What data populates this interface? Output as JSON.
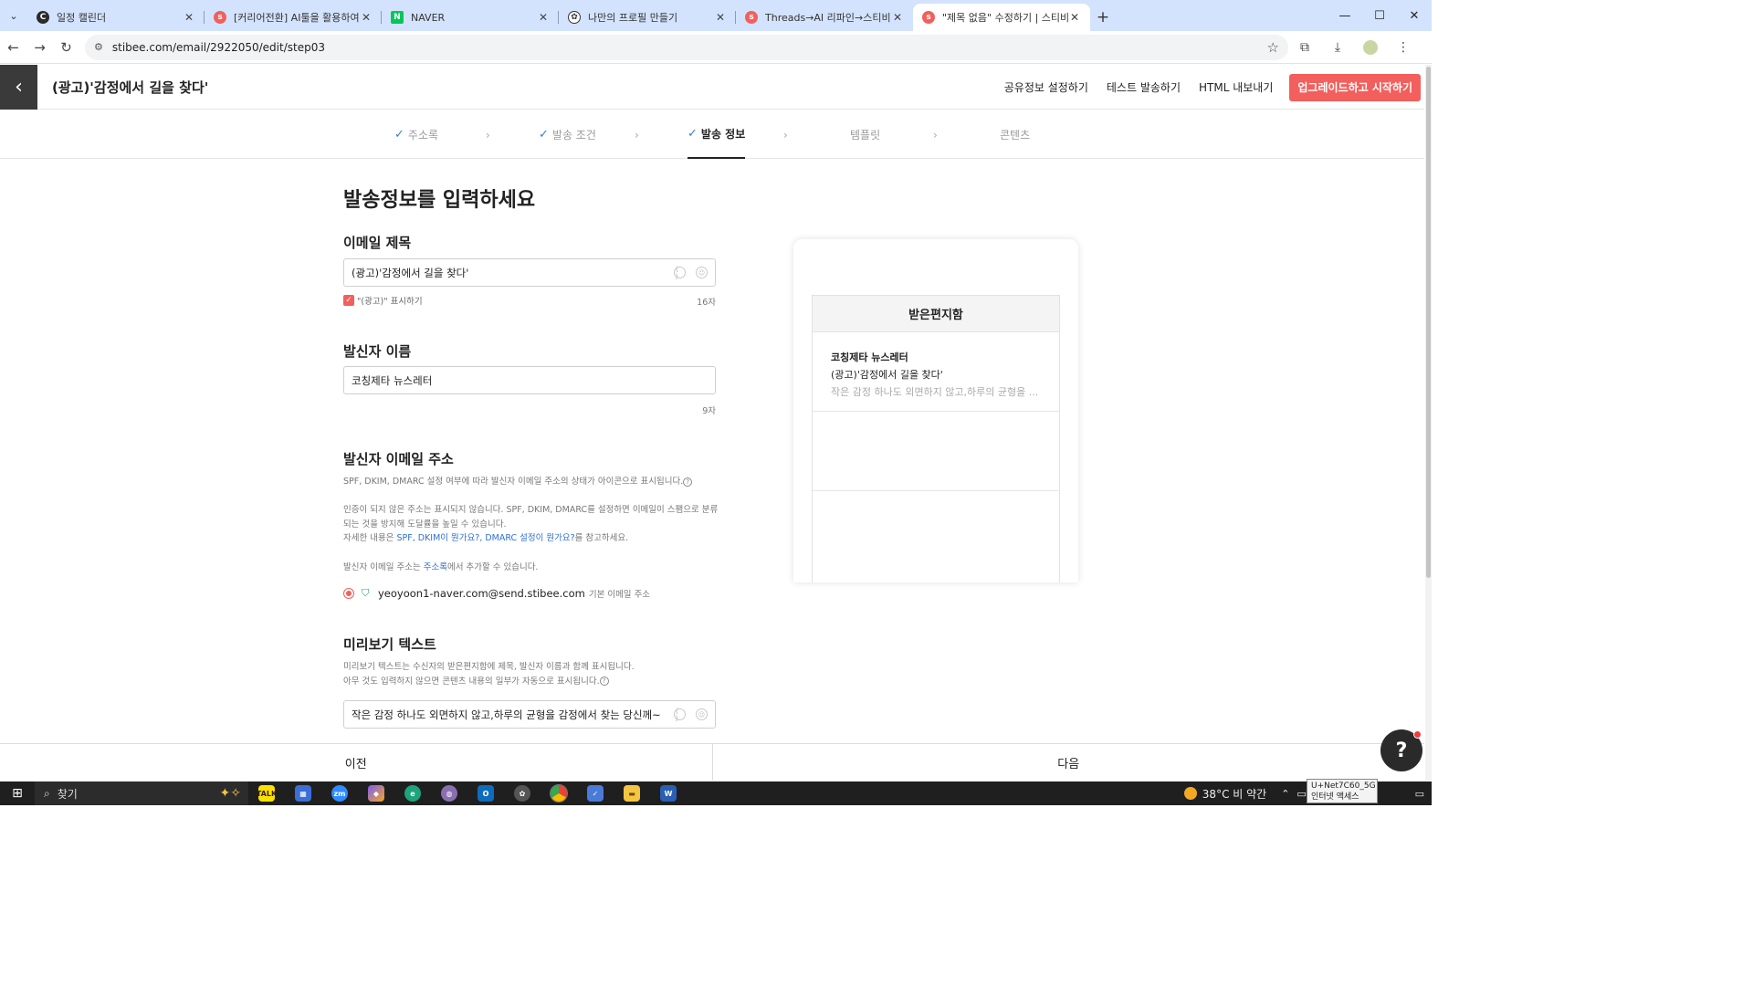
{
  "browser": {
    "tabs": [
      {
        "title": "일정 캘린더",
        "icon": "calendar-c-icon",
        "color": "#2b2b2b"
      },
      {
        "title": "[커리어전환] AI툴을 활용하여",
        "icon": "stibee-icon",
        "color": "#f25f5c"
      },
      {
        "title": "NAVER",
        "icon": "naver-icon",
        "color": "#03c75a"
      },
      {
        "title": "나만의 프로필 만들기",
        "icon": "openai-icon",
        "color": "#333333"
      },
      {
        "title": "Threads→AI 리파인→스티비",
        "icon": "stibee-icon",
        "color": "#f25f5c"
      },
      {
        "title": "\"제목 없음\" 수정하기 | 스티비",
        "icon": "stibee-icon",
        "color": "#f25f5c"
      }
    ],
    "url": "stibee.com/email/2922050/edit/step03"
  },
  "header": {
    "title": "(광고)'감정에서 길을 찾다'",
    "actions": [
      "공유정보 설정하기",
      "테스트 발송하기",
      "HTML 내보내기"
    ],
    "upgrade": "업그레이드하고 시작하기",
    "accent": "#f25f5c"
  },
  "steps": [
    {
      "label": "주소록",
      "done": true
    },
    {
      "label": "발송 조건",
      "done": true
    },
    {
      "label": "발송 정보",
      "done": true,
      "current": true
    },
    {
      "label": "템플릿",
      "done": false
    },
    {
      "label": "콘텐츠",
      "done": false
    }
  ],
  "form": {
    "heading": "발송정보를 입력하세요",
    "subject": {
      "label": "이메일 제목",
      "value": "(광고)'감정에서 길을 찾다'",
      "ad_check": "\"(광고)\" 표시하기",
      "count": "16자"
    },
    "sender_name": {
      "label": "발신자 이름",
      "value": "코칭제타 뉴스레터",
      "count": "9자"
    },
    "sender_email": {
      "label": "발신자 이메일 주소",
      "help1": "SPF, DKIM, DMARC 설정 여부에 따라 발신자 이메일 주소의 상태가 아이콘으로 표시됩니다.",
      "help2a": "인증이 되지 않은 주소는 표시되지 않습니다. SPF, DKIM, DMARC를 설정하면 이메일이 스팸으로 분류",
      "help2b": "되는 것을 방지해 도달률을 높일 수 있습니다.",
      "help3_pre": "자세한 내용은 ",
      "help3_link": "SPF, DKIM이 뭔가요?, DMARC 설정이 뭔가요?",
      "help3_post": "를 참고하세요.",
      "help4_pre": "발신자 이메일 주소는 ",
      "help4_link": "주소록",
      "help4_post": "에서 추가할 수 있습니다.",
      "address": "yeoyoon1-naver.com@send.stibee.com",
      "default_tag": "기본 이메일 주소"
    },
    "preview_text": {
      "label": "미리보기 텍스트",
      "help1": "미리보기 텍스트는 수신자의 받은편지함에 제목, 발신자 이름과 함께 표시됩니다.",
      "help2": "아무 것도 입력하지 않으면 콘텐츠 내용의 일부가 자동으로 표시됩니다.",
      "value": "작은 감정 하나도 외면하지 않고,하루의 균형을 감정에서 찾는 당신께~"
    }
  },
  "preview": {
    "inbox_title": "받은편지함",
    "from": "코칭제타 뉴스레터",
    "subject": "(광고)'감정에서 길을 찾다'",
    "snippet": "작은 감정 하나도 외면하지 않고,하루의 균형을 ..."
  },
  "bottom": {
    "prev": "이전",
    "next": "다음"
  },
  "taskbar": {
    "search": "찾기",
    "weather": "38°C  비 약간",
    "network_tip_line1": "U+Net7C60_5G",
    "network_tip_line2": "인터넷 액세스"
  }
}
